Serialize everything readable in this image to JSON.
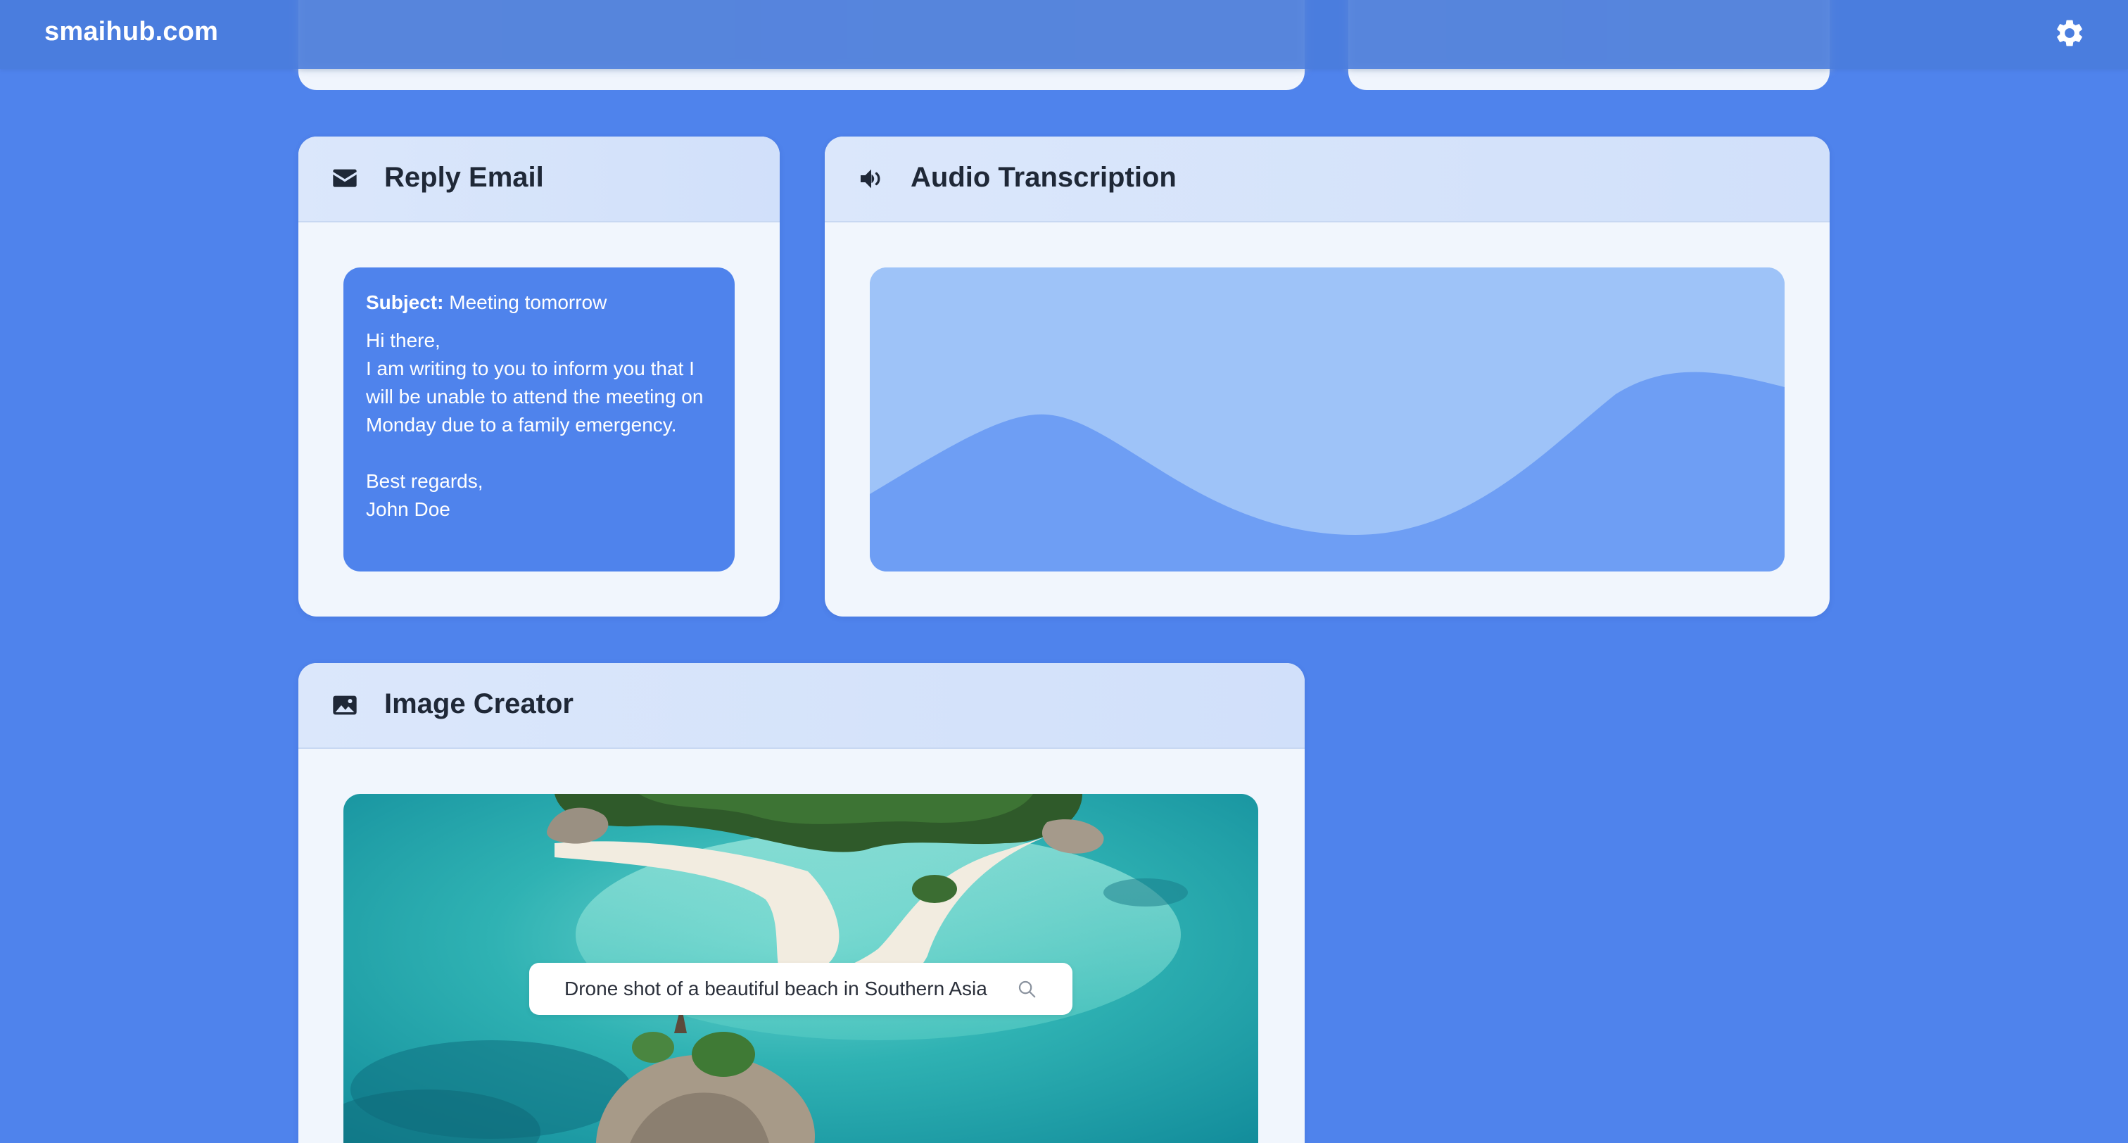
{
  "header": {
    "brand": "smaihub.com",
    "settings_icon": "gear-icon"
  },
  "reply_email": {
    "title": "Reply Email",
    "icon": "envelope-icon",
    "subject_label": "Subject:",
    "subject_value": " Meeting tomorrow",
    "greeting": "Hi there,",
    "body": "I am writing to you to inform you that I will be unable to attend the meeting on Monday due to a family emergency.",
    "closing": "Best regards,",
    "signature": "John Doe"
  },
  "audio_transcription": {
    "title": "Audio Transcription",
    "icon": "speaker-icon"
  },
  "image_creator": {
    "title": "Image Creator",
    "icon": "image-icon",
    "prompt_value": "Drone shot of a beautiful beach in Southern Asia",
    "prompt_icon": "search-icon"
  },
  "colors": {
    "background": "#4f83ec",
    "card": "#f1f6fd",
    "card_header": "#d6e3fa",
    "wave_light": "#9ec3f8",
    "wave_dark": "#6e9ef4"
  }
}
